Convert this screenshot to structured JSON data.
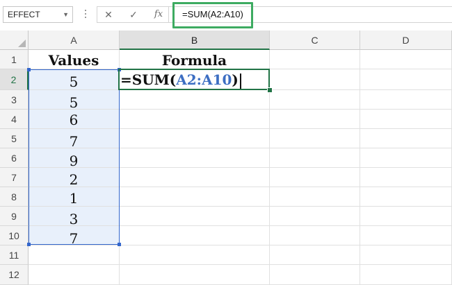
{
  "formula_bar": {
    "name_box": "EFFECT",
    "cancel_glyph": "✕",
    "enter_glyph": "✓",
    "fx_glyph": "fx",
    "formula": "=SUM(A2:A10)"
  },
  "columns": [
    "A",
    "B",
    "C",
    "D"
  ],
  "rows": [
    "1",
    "2",
    "3",
    "4",
    "5",
    "6",
    "7",
    "8",
    "9",
    "10",
    "11",
    "12"
  ],
  "header_cells": {
    "A1": "Values",
    "B1": "Formula"
  },
  "values": [
    "5",
    "5",
    "6",
    "7",
    "9",
    "2",
    "1",
    "3",
    "7"
  ],
  "active_cell": {
    "prefix": "=SUM(",
    "reference": "A2:A10",
    "suffix": ")"
  },
  "colors": {
    "selection_accent": "#217346",
    "range_border": "#3366cc",
    "range_fill": "#e8f0fb",
    "formula_highlight": "#3dab61",
    "reference_text": "#3c6ec2"
  }
}
